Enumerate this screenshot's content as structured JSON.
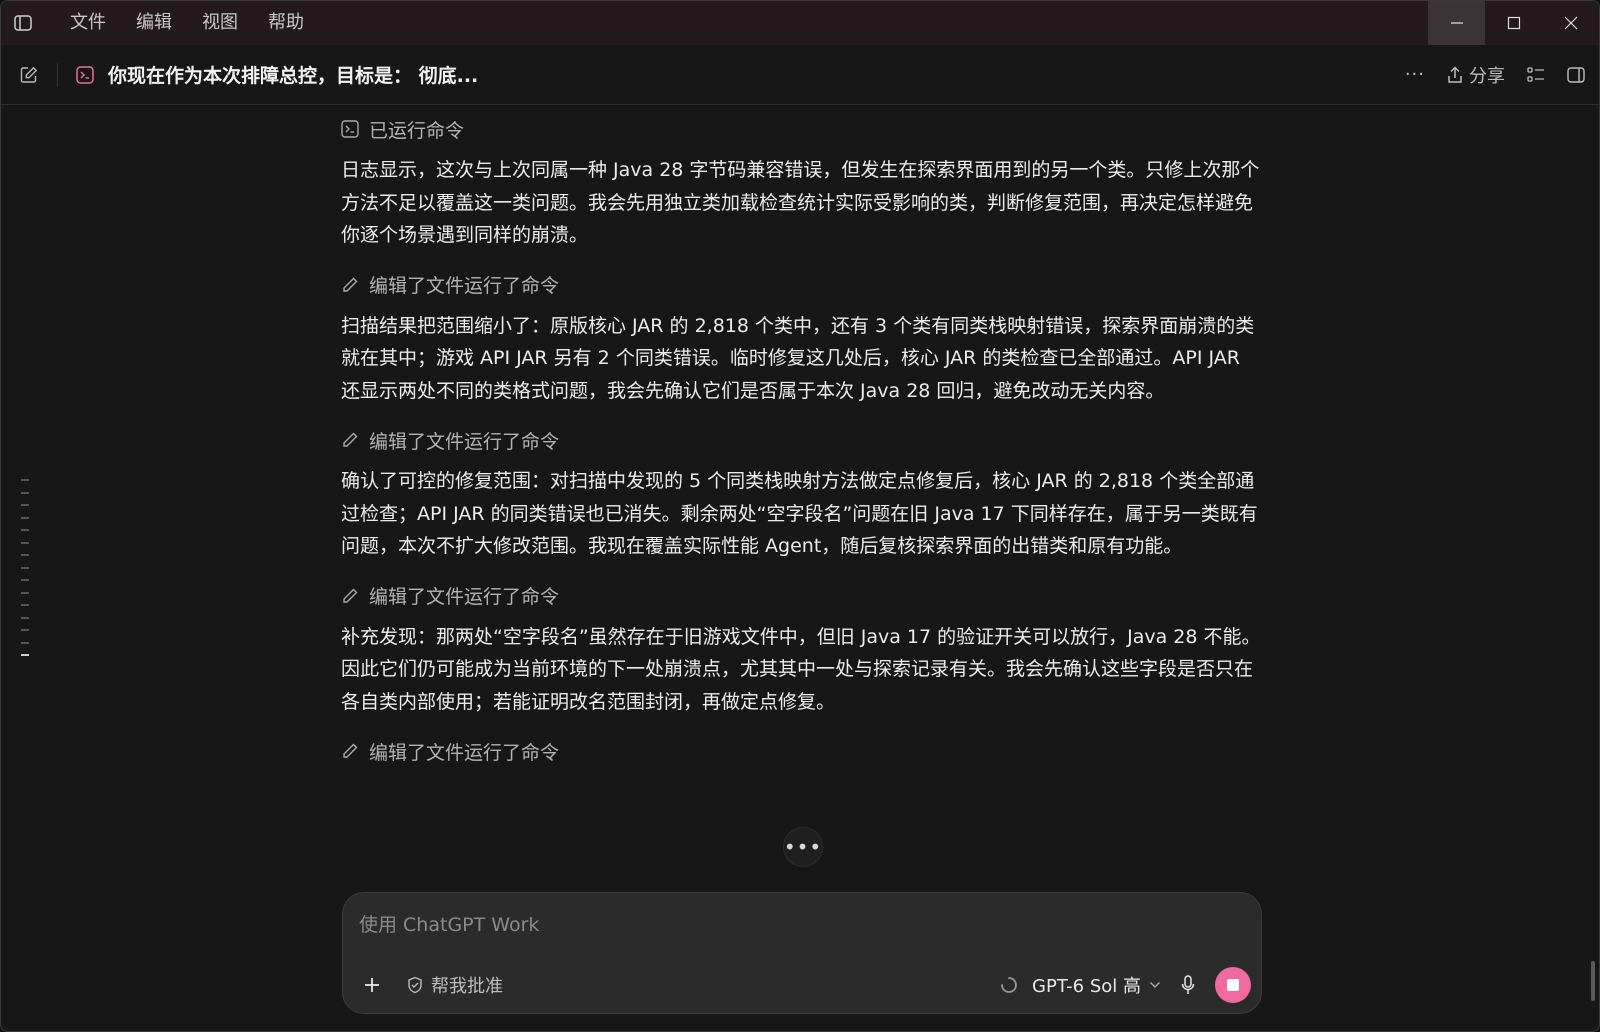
{
  "menu": {
    "file": "文件",
    "edit": "编辑",
    "view": "视图",
    "help": "帮助"
  },
  "header": {
    "title": "你现在作为本次排障总控，目标是： 彻底...",
    "share_label": "分享"
  },
  "messages": [
    {
      "type": "action",
      "icon": "terminal-icon",
      "label": "已运行命令"
    },
    {
      "type": "text",
      "text": "日志显示，这次与上次同属一种 Java 28 字节码兼容错误，但发生在探索界面用到的另一个类。只修上次那个方法不足以覆盖这一类问题。我会先用独立类加载检查统计实际受影响的类，判断修复范围，再决定怎样避免你逐个场景遇到同样的崩溃。"
    },
    {
      "type": "action",
      "icon": "pencil-icon",
      "label": "编辑了文件运行了命令"
    },
    {
      "type": "text",
      "text": "扫描结果把范围缩小了：原版核心 JAR 的 2,818 个类中，还有 3 个类有同类栈映射错误，探索界面崩溃的类就在其中；游戏 API JAR 另有 2 个同类错误。临时修复这几处后，核心 JAR 的类检查已全部通过。API JAR 还显示两处不同的类格式问题，我会先确认它们是否属于本次 Java 28 回归，避免改动无关内容。"
    },
    {
      "type": "action",
      "icon": "pencil-icon",
      "label": "编辑了文件运行了命令"
    },
    {
      "type": "text",
      "text": "确认了可控的修复范围：对扫描中发现的 5 个同类栈映射方法做定点修复后，核心 JAR 的 2,818 个类全部通过检查；API JAR 的同类错误也已消失。剩余两处“空字段名”问题在旧 Java 17 下同样存在，属于另一类既有问题，本次不扩大修改范围。我现在覆盖实际性能 Agent，随后复核探索界面的出错类和原有功能。"
    },
    {
      "type": "action",
      "icon": "pencil-icon",
      "label": "编辑了文件运行了命令"
    },
    {
      "type": "text",
      "text": "补充发现：那两处“空字段名”虽然存在于旧游戏文件中，但旧 Java 17 的验证开关可以放行，Java 28 不能。因此它们仍可能成为当前环境的下一处崩溃点，尤其其中一处与探索记录有关。我会先确认这些字段是否只在各自类内部使用；若能证明改名范围封闭，再做定点修复。"
    },
    {
      "type": "action",
      "icon": "pencil-icon",
      "label": "编辑了文件运行了命令"
    }
  ],
  "more_label": "•••",
  "composer": {
    "placeholder": "使用 ChatGPT Work",
    "approve_label": "帮我批准",
    "model_label": "GPT-6 Sol 高"
  },
  "colors": {
    "accent": "#f06aa0",
    "background": "#171717",
    "titlebar": "#241a1e"
  }
}
